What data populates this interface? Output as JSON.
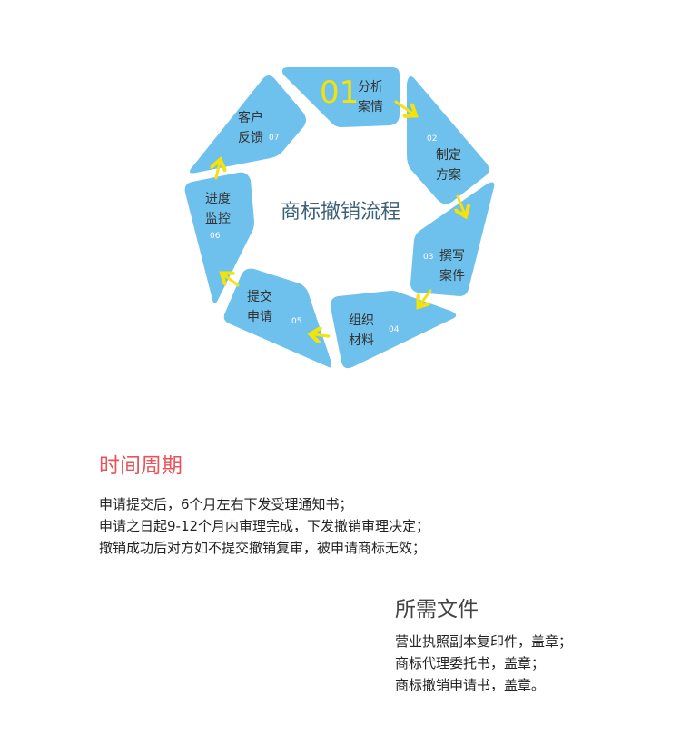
{
  "diagram": {
    "center_title": "商标撤销流程",
    "steps": [
      {
        "num": "01",
        "line1": "分析",
        "line2": "案情"
      },
      {
        "num": "02",
        "line1": "制定",
        "line2": "方案"
      },
      {
        "num": "03",
        "line1": "撰写",
        "line2": "案件"
      },
      {
        "num": "04",
        "line1": "组织",
        "line2": "材料"
      },
      {
        "num": "05",
        "line1": "提交",
        "line2": "申请"
      },
      {
        "num": "06",
        "line1": "进度",
        "line2": "监控"
      },
      {
        "num": "07",
        "line1": "客户",
        "line2": "反馈"
      }
    ],
    "colors": {
      "segment": "#6ec1ec",
      "arrow": "#f4e20a",
      "center_title": "#3d6178",
      "step_text": "#333333",
      "step_number": "#ffffff"
    }
  },
  "period": {
    "title": "时间周期",
    "lines": [
      "申请提交后，6个月左右下发受理通知书；",
      "申请之日起9-12个月内审理完成，下发撤销审理决定；",
      "撤销成功后对方如不提交撤销复审，被申请商标无效；"
    ]
  },
  "docs": {
    "title": "所需文件",
    "lines": [
      "营业执照副本复印件，盖章；",
      "商标代理委托书，盖章；",
      "商标撤销申请书，盖章。"
    ]
  }
}
